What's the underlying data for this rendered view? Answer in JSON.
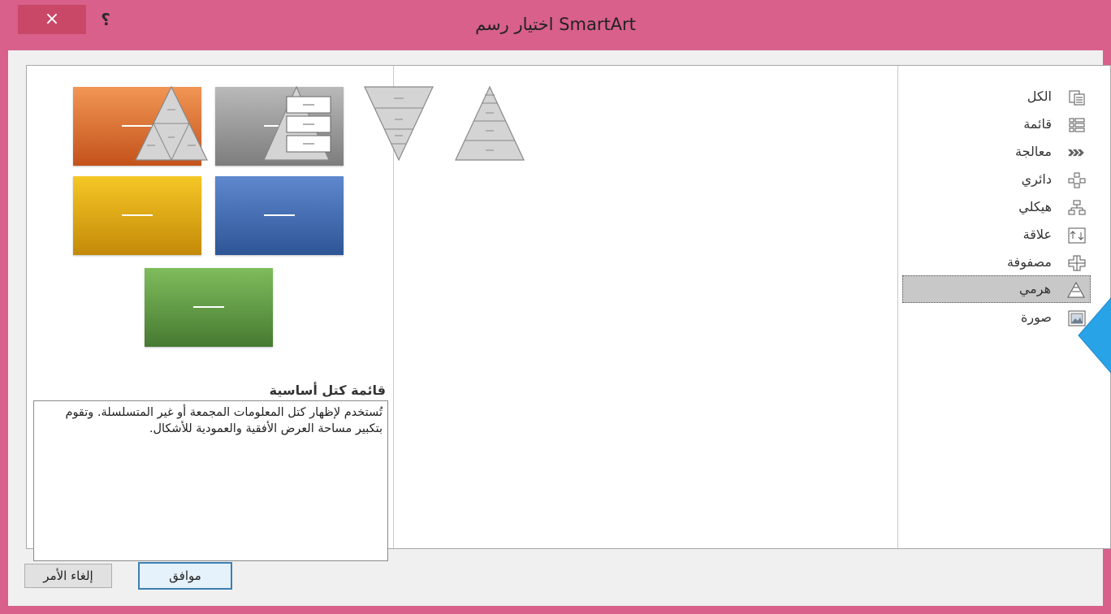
{
  "window": {
    "title": "اختيار رسم SmartArt",
    "close_glyph": "×",
    "help_glyph": "؟"
  },
  "categories": [
    {
      "label": "الكل",
      "icon": "all-icon"
    },
    {
      "label": "قائمة",
      "icon": "list-icon"
    },
    {
      "label": "معالجة",
      "icon": "process-icon"
    },
    {
      "label": "دائري",
      "icon": "cycle-icon"
    },
    {
      "label": "هيكلي",
      "icon": "hierarchy-icon"
    },
    {
      "label": "علاقة",
      "icon": "relationship-icon"
    },
    {
      "label": "مصفوفة",
      "icon": "matrix-icon"
    },
    {
      "label": "هرمي",
      "icon": "pyramid-icon",
      "selected": true
    },
    {
      "label": "صورة",
      "icon": "picture-icon"
    }
  ],
  "layouts": [
    {
      "icon": "basic-pyramid-icon"
    },
    {
      "icon": "inverted-pyramid-icon"
    },
    {
      "icon": "pyramid-list-icon"
    },
    {
      "icon": "segmented-pyramid-icon"
    }
  ],
  "preview": {
    "title": "قائمة كتل أساسية",
    "description": "تُستخدم لإظهار كتل المعلومات المجمعة أو غير المتسلسلة. وتقوم بتكبير مساحة العرض الأفقية والعمودية للأشكال.",
    "block_colors": [
      "#d4621e",
      "#8c8c8c",
      "#e0a812",
      "#3b68b0",
      "#579244"
    ]
  },
  "buttons": {
    "ok_label": "موافق",
    "cancel_label": "إلغاء الأمر"
  },
  "colors": {
    "title_bar": "#d8608a",
    "selection": "#c8c8c8",
    "callout": "#29a3e8"
  }
}
